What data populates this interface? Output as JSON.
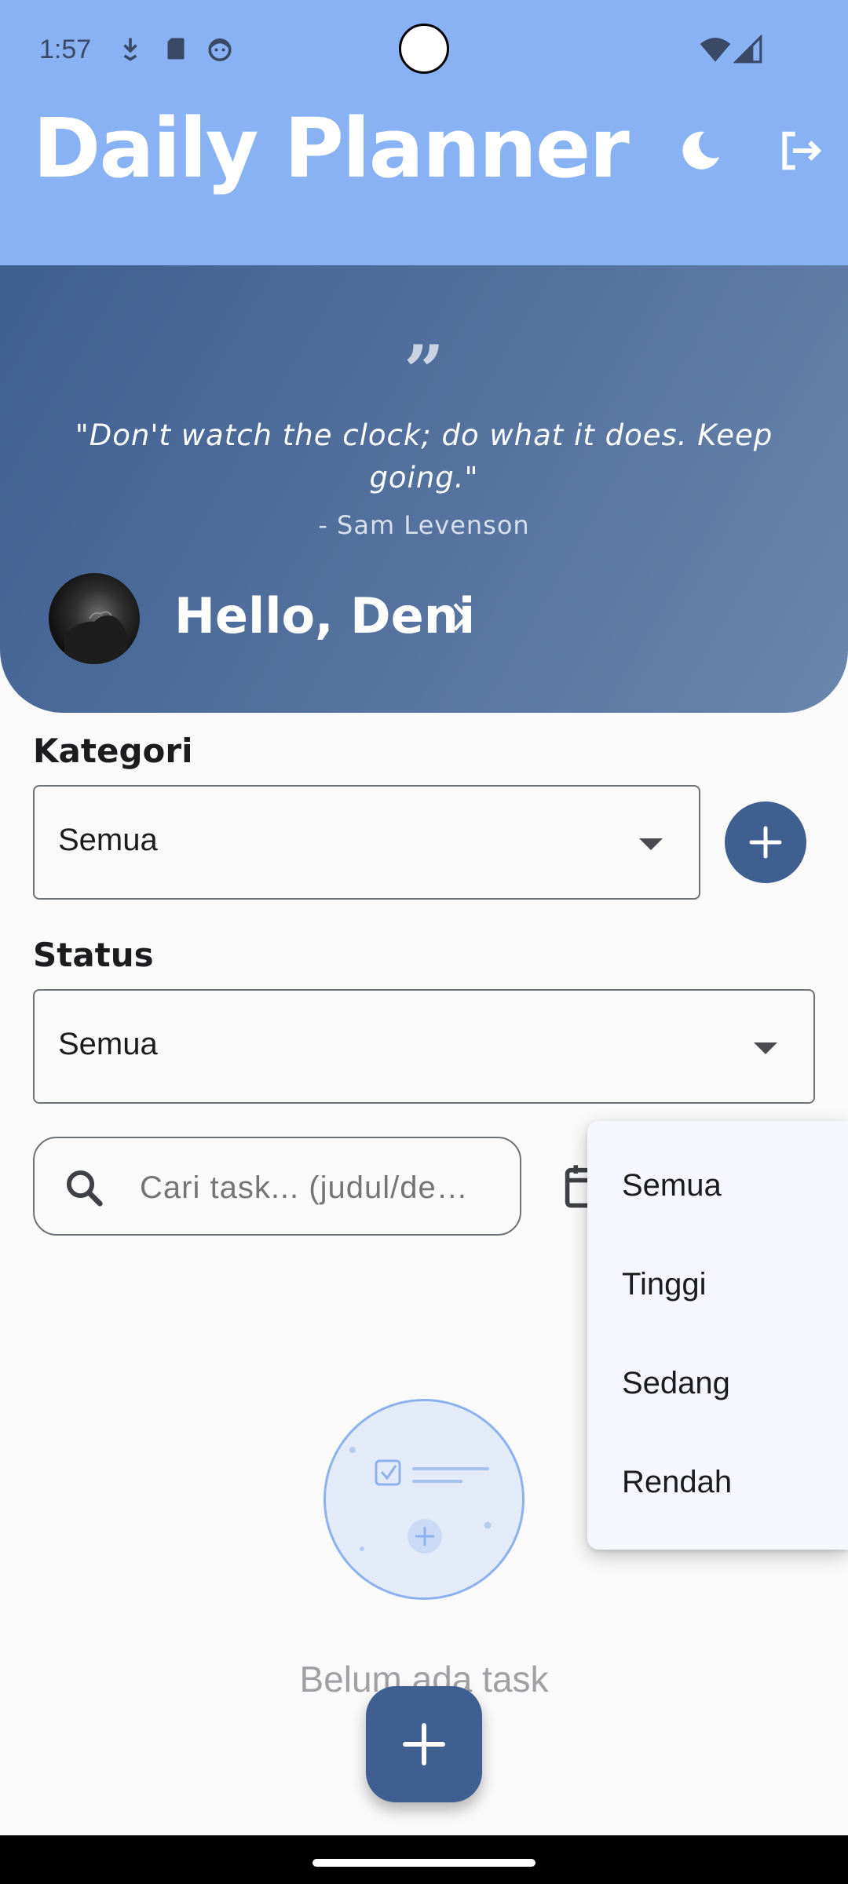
{
  "status_bar": {
    "time": "1:57",
    "icons": [
      "download-icon",
      "sd-card-icon",
      "face-icon",
      "wifi-icon",
      "signal-icon"
    ]
  },
  "header": {
    "title": "Daily Planner",
    "actions": [
      "moon-icon",
      "logout-icon"
    ],
    "bg_color": "#89b2f5"
  },
  "banner": {
    "quote": "\"Don't watch the clock; do what it does. Keep going.\"",
    "author": "- Sam Levenson",
    "greeting": "Hello, Deni",
    "gradient_colors": [
      "#3f5f91",
      "#6a86ad"
    ]
  },
  "filters": {
    "kategori_label": "Kategori",
    "kategori_value": "Semua",
    "status_label": "Status",
    "status_value": "Semua",
    "search_placeholder": "Cari task... (judul/de…"
  },
  "priority_menu": {
    "items": [
      "Semua",
      "Tinggi",
      "Sedang",
      "Rendah"
    ]
  },
  "empty_state": {
    "text": "Belum ada task"
  },
  "colors": {
    "accent": "#3f5f91",
    "light_accent": "#89b2f5"
  }
}
